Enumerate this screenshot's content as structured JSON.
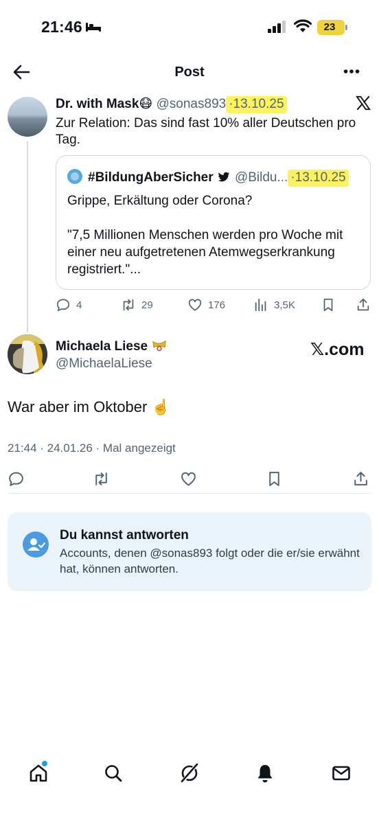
{
  "status_bar": {
    "time": "21:46",
    "battery": "23",
    "icons": [
      "bed-icon",
      "signal-icon",
      "wifi-icon",
      "battery-icon"
    ]
  },
  "header": {
    "title": "Post"
  },
  "post": {
    "author_name": "Dr. with Mask😷",
    "handle": "@sonas893",
    "separator": "·",
    "date": "13.10.25",
    "text": "Zur Relation: Das sind fast 10% aller Deutschen pro Tag.",
    "quote": {
      "author_name": "#BildungAberSicher",
      "handle": "@Bildu...",
      "separator": "·",
      "date": "13.10.25",
      "text": "Grippe, Erkältung oder Corona?\n\n\"7,5 Millionen Menschen werden pro Woche mit einer neu aufgetretenen Atemwegserkrankung registriert.\"..."
    },
    "stats": {
      "replies": "4",
      "reposts": "29",
      "likes": "176",
      "views": "3,5K"
    }
  },
  "reply": {
    "author_name": "Michaela Liese",
    "handle": "@MichaelaLiese",
    "watermark": "𝕏.com",
    "text": "War aber im Oktober ☝️",
    "meta": "21:44 · 24.01.26 · Mal angezeigt"
  },
  "reply_info": {
    "title": "Du kannst antworten",
    "body": "Accounts, denen @sonas893 folgt oder die er/sie erwähnt hat, können antworten."
  },
  "colors": {
    "accent": "#1d9bf0",
    "muted_text": "#536471",
    "highlight": "#fcf260",
    "info_background": "#eaf3f9"
  }
}
